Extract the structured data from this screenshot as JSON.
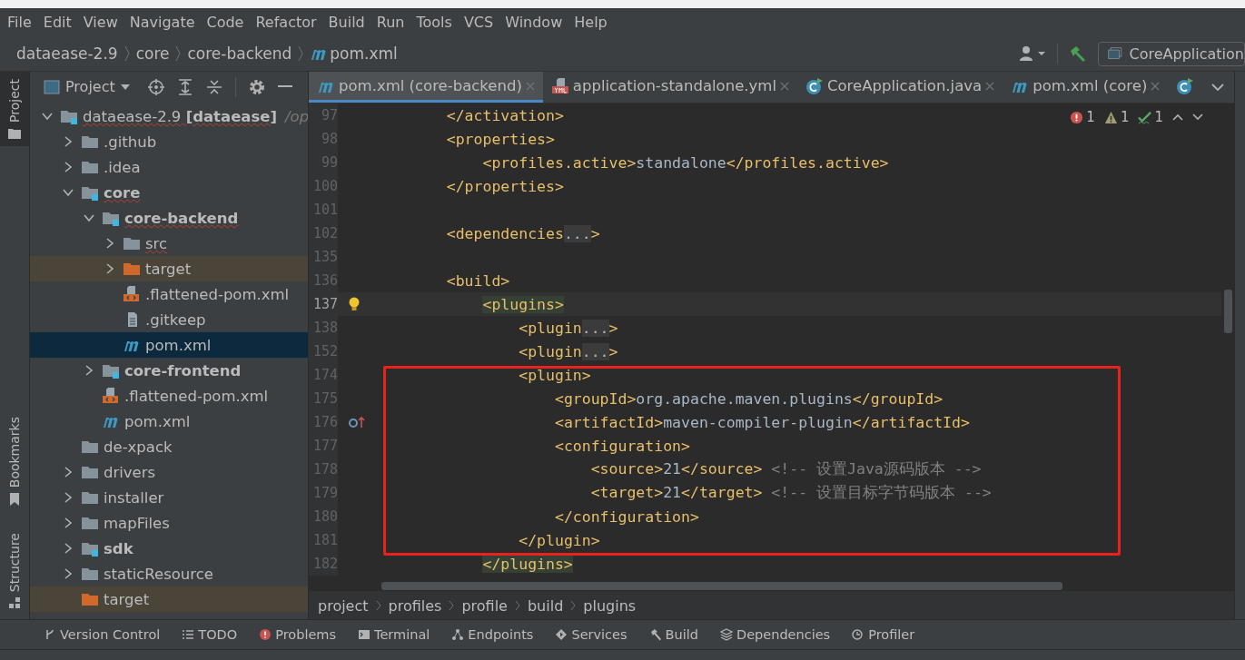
{
  "menu": [
    "File",
    "Edit",
    "View",
    "Navigate",
    "Code",
    "Refactor",
    "Build",
    "Run",
    "Tools",
    "VCS",
    "Window",
    "Help"
  ],
  "nav_path": [
    {
      "label": "dataease-2.9",
      "kind": "folder"
    },
    {
      "label": "core",
      "kind": "folder"
    },
    {
      "label": "core-backend",
      "kind": "folder"
    },
    {
      "label": "pom.xml",
      "kind": "maven"
    }
  ],
  "run_config": "CoreApplication",
  "project_panel": {
    "title": "Project",
    "tree": [
      {
        "label": "dataease-2.9 **[dataease]**",
        "path": "/op",
        "kind": "module",
        "bold": false,
        "error": true,
        "selected": false,
        "expanded": true,
        "children": [
          {
            "label": ".github",
            "kind": "folder",
            "bold": false,
            "error": false,
            "selected": false,
            "expanded": false
          },
          {
            "label": ".idea",
            "kind": "folder",
            "bold": false,
            "error": false,
            "selected": false,
            "expanded": false
          },
          {
            "label": "core",
            "kind": "module",
            "bold": true,
            "error": true,
            "selected": false,
            "expanded": true,
            "children": [
              {
                "label": "core-backend",
                "kind": "module",
                "bold": true,
                "error": true,
                "selected": false,
                "expanded": true,
                "children": [
                  {
                    "label": "src",
                    "kind": "folder",
                    "bold": false,
                    "error": true,
                    "selected": false,
                    "expanded": false
                  },
                  {
                    "label": "target",
                    "kind": "excluded",
                    "bold": false,
                    "error": false,
                    "selected": false,
                    "expanded": false
                  },
                  {
                    "label": ".flattened-pom.xml",
                    "kind": "xml",
                    "bold": false,
                    "error": false,
                    "selected": false
                  },
                  {
                    "label": ".gitkeep",
                    "kind": "file",
                    "bold": false,
                    "error": false,
                    "selected": false
                  },
                  {
                    "label": "pom.xml",
                    "kind": "maven",
                    "bold": false,
                    "error": false,
                    "selected": true
                  }
                ]
              },
              {
                "label": "core-frontend",
                "kind": "module",
                "bold": true,
                "error": false,
                "selected": false,
                "expanded": false
              },
              {
                "label": ".flattened-pom.xml",
                "kind": "xml",
                "bold": false,
                "error": false,
                "selected": false
              },
              {
                "label": "pom.xml",
                "kind": "maven",
                "bold": false,
                "error": false,
                "selected": false
              }
            ]
          },
          {
            "label": "de-xpack",
            "kind": "folder",
            "bold": false,
            "error": false,
            "selected": false
          },
          {
            "label": "drivers",
            "kind": "folder",
            "bold": false,
            "error": false,
            "selected": false,
            "expanded": false
          },
          {
            "label": "installer",
            "kind": "folder",
            "bold": false,
            "error": false,
            "selected": false,
            "expanded": false
          },
          {
            "label": "mapFiles",
            "kind": "folder",
            "bold": false,
            "error": false,
            "selected": false,
            "expanded": false
          },
          {
            "label": "sdk",
            "kind": "module",
            "bold": true,
            "error": false,
            "selected": false,
            "expanded": false
          },
          {
            "label": "staticResource",
            "kind": "folder",
            "bold": false,
            "error": false,
            "selected": false,
            "expanded": false
          },
          {
            "label": "target",
            "kind": "excluded",
            "bold": false,
            "error": false,
            "selected": false
          }
        ]
      }
    ]
  },
  "side_tabs": [
    {
      "label": "Project",
      "selected": true
    },
    {
      "label": "Bookmarks",
      "selected": false
    },
    {
      "label": "Structure",
      "selected": false
    }
  ],
  "editor_tabs": [
    {
      "label": "pom.xml (core-backend)",
      "kind": "maven",
      "selected": true
    },
    {
      "label": "application-standalone.yml",
      "kind": "yml",
      "selected": false
    },
    {
      "label": "CoreApplication.java",
      "kind": "class",
      "selected": false
    },
    {
      "label": "pom.xml (core)",
      "kind": "maven",
      "selected": false
    },
    {
      "kind": "class",
      "selected": false
    }
  ],
  "inspections": [
    {
      "kind": "error",
      "count": "1"
    },
    {
      "kind": "warning",
      "count": "1"
    },
    {
      "kind": "typo",
      "count": "1"
    }
  ],
  "code": [
    {
      "number": "97",
      "kind": "plain",
      "current": false,
      "boxed": false,
      "segments": [
        {
          "kind": "tag",
          "text": "    </activation>"
        }
      ]
    },
    {
      "number": "98",
      "kind": "plain",
      "current": false,
      "boxed": false,
      "segments": [
        {
          "kind": "tag",
          "text": "    <properties>"
        }
      ]
    },
    {
      "number": "99",
      "kind": "plain",
      "current": false,
      "boxed": false,
      "segments": [
        {
          "kind": "tag",
          "text": "        <profiles.active>"
        },
        {
          "kind": "plain",
          "text": "standalone"
        },
        {
          "kind": "tag",
          "text": "</profiles.active>"
        }
      ]
    },
    {
      "number": "100",
      "kind": "plain",
      "current": false,
      "boxed": false,
      "segments": [
        {
          "kind": "tag",
          "text": "    </properties>"
        }
      ]
    },
    {
      "number": "101",
      "kind": "plain",
      "current": false,
      "boxed": false
    },
    {
      "number": "102",
      "kind": "plain",
      "current": false,
      "boxed": false,
      "segments": [
        {
          "kind": "tag",
          "text": "    <dependencies"
        },
        {
          "kind": "fold",
          "text": "..."
        },
        {
          "kind": "tag",
          "text": ">"
        }
      ]
    },
    {
      "number": "135",
      "kind": "plain",
      "current": false,
      "boxed": false
    },
    {
      "number": "136",
      "kind": "plain",
      "current": false,
      "boxed": false,
      "segments": [
        {
          "kind": "tag",
          "text": "    <build>"
        }
      ]
    },
    {
      "number": "137",
      "kind": "bulb",
      "current": true,
      "boxed": false,
      "segments": [
        {
          "kind": "match",
          "text": "<plugins>"
        }
      ]
    },
    {
      "number": "138",
      "kind": "plain",
      "current": false,
      "boxed": false,
      "segments": [
        {
          "kind": "tag",
          "text": "            <plugin"
        },
        {
          "kind": "fold",
          "text": "..."
        },
        {
          "kind": "tag",
          "text": ">"
        }
      ]
    },
    {
      "number": "152",
      "kind": "plain",
      "current": false,
      "boxed": false,
      "segments": [
        {
          "kind": "tag",
          "text": "            <plugin"
        },
        {
          "kind": "fold",
          "text": "..."
        },
        {
          "kind": "tag",
          "text": ">"
        }
      ]
    },
    {
      "number": "174",
      "kind": "plain",
      "current": false,
      "boxed": true,
      "segments": [
        {
          "kind": "tag",
          "text": "            <plugin>"
        }
      ]
    },
    {
      "number": "175",
      "kind": "plain",
      "current": false,
      "boxed": true,
      "segments": [
        {
          "kind": "tag",
          "text": "                <groupId>"
        },
        {
          "kind": "plain",
          "text": "org.apache.maven.plugins"
        },
        {
          "kind": "tag",
          "text": "</groupId>"
        }
      ]
    },
    {
      "number": "176",
      "kind": "override",
      "current": false,
      "boxed": true,
      "segments": [
        {
          "kind": "tag",
          "text": "                <artifactId>"
        },
        {
          "kind": "plain",
          "text": "maven-compiler-plugin"
        },
        {
          "kind": "tag",
          "text": "</artifactId>"
        }
      ]
    },
    {
      "number": "177",
      "kind": "plain",
      "current": false,
      "boxed": true,
      "segments": [
        {
          "kind": "tag",
          "text": "                <configuration>"
        }
      ]
    },
    {
      "number": "178",
      "kind": "plain",
      "current": false,
      "boxed": true,
      "segments": [
        {
          "kind": "tag",
          "text": "                    <source>"
        },
        {
          "kind": "plain",
          "text": "21"
        },
        {
          "kind": "tag",
          "text": "</source>"
        },
        {
          "kind": "comment",
          "text": " <!-- 设置Java源码版本 -->"
        }
      ]
    },
    {
      "number": "179",
      "kind": "plain",
      "current": false,
      "boxed": true,
      "segments": [
        {
          "kind": "tag",
          "text": "                    <target>"
        },
        {
          "kind": "plain",
          "text": "21"
        },
        {
          "kind": "tag",
          "text": "</target>"
        },
        {
          "kind": "comment",
          "text": " <!-- 设置目标字节码版本 -->"
        }
      ]
    },
    {
      "number": "180",
      "kind": "plain",
      "current": false,
      "boxed": true,
      "segments": [
        {
          "kind": "tag",
          "text": "                </configuration>"
        }
      ]
    },
    {
      "number": "181",
      "kind": "plain",
      "current": false,
      "boxed": true,
      "segments": [
        {
          "kind": "tag",
          "text": "            </plugin>"
        }
      ]
    },
    {
      "number": "182",
      "kind": "plain",
      "current": false,
      "boxed": false,
      "segments": [
        {
          "kind": "match",
          "text": "</plugins>"
        }
      ]
    }
  ],
  "breadcrumb": [
    "project",
    "profiles",
    "profile",
    "build",
    "plugins"
  ],
  "tool_windows": [
    {
      "label": "Version Control",
      "kind": "branch"
    },
    {
      "label": "TODO",
      "kind": "list"
    },
    {
      "label": "Problems",
      "kind": "problems"
    },
    {
      "label": "Terminal",
      "kind": "terminal"
    },
    {
      "label": "Endpoints",
      "kind": "endpoints"
    },
    {
      "label": "Services",
      "kind": "services"
    },
    {
      "label": "Build",
      "kind": "hammer"
    },
    {
      "label": "Dependencies",
      "kind": "layers"
    },
    {
      "label": "Profiler",
      "kind": "profiler"
    }
  ]
}
